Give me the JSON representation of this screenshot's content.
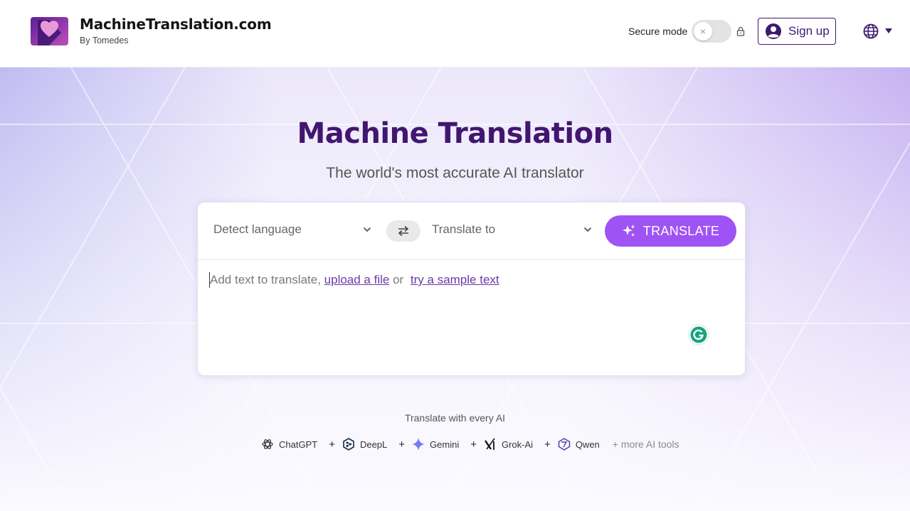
{
  "header": {
    "brand_name": "MachineTranslation.com",
    "brand_sub": "By Tomedes",
    "secure_mode_label": "Secure mode",
    "toggle_symbol": "×",
    "signup_label": "Sign up",
    "icons": [
      "logo",
      "lock-icon",
      "user-icon",
      "globe-icon",
      "caret-down-icon"
    ]
  },
  "hero": {
    "title": "Machine Translation",
    "subtitle": "The world's most accurate AI translator"
  },
  "translator": {
    "source_language": "Detect language",
    "target_language": "Translate to",
    "translate_button": "TRANSLATE",
    "input_prefix": "Add text to translate, ",
    "upload_link": "upload a file",
    "or_text": " or ",
    "sample_link": "try a sample text"
  },
  "ai_tools": {
    "heading": "Translate with every AI",
    "items": [
      "ChatGPT",
      "DeepL",
      "Gemini",
      "Grok-Ai",
      "Qwen"
    ],
    "plus": "+",
    "more": "+ more AI tools"
  },
  "colors": {
    "brand_dark": "#421670",
    "accent": "#a053f4",
    "link": "#6a3aa8"
  }
}
